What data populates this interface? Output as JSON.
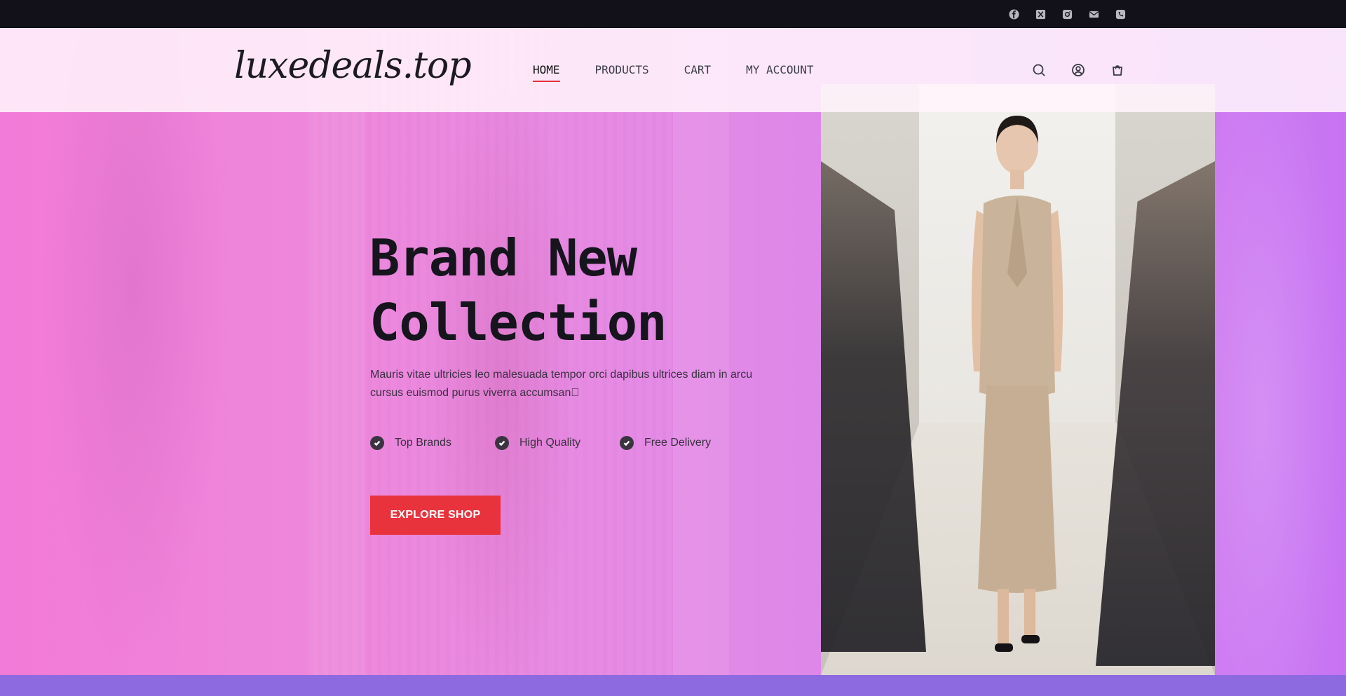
{
  "topbar": {
    "social_icons": [
      "facebook-icon",
      "x-twitter-icon",
      "instagram-icon",
      "email-icon",
      "phone-icon"
    ]
  },
  "header": {
    "logo": "luxedeals.top",
    "nav": [
      {
        "label": "HOME",
        "active": true
      },
      {
        "label": "PRODUCTS",
        "active": false
      },
      {
        "label": "CART",
        "active": false
      },
      {
        "label": "MY ACCOUNT",
        "active": false
      }
    ],
    "icons": [
      "search-icon",
      "account-icon",
      "cart-icon"
    ]
  },
  "hero": {
    "title_line1": "Brand New",
    "title_line2": "Collection",
    "description": "Mauris vitae ultricies leo malesuada tempor orci dapibus ultrices diam in arcu cursus euismod purus viverra accumsan\u0000",
    "features": [
      {
        "label": "Top Brands"
      },
      {
        "label": "High Quality"
      },
      {
        "label": "Free Delivery"
      }
    ],
    "cta_label": "EXPLORE SHOP"
  },
  "colors": {
    "accent": "#e8333d",
    "topbar": "#12111a",
    "hero_gradient_start": "#f27ad8",
    "hero_gradient_end": "#c774f3",
    "bottom_strip": "#8e6ae0"
  }
}
